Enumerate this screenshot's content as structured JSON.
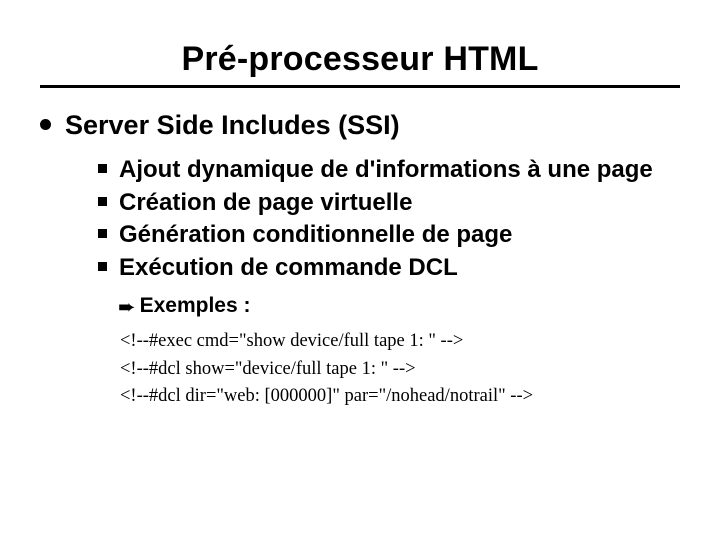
{
  "title": "Pré-processeur HTML",
  "lvl1": {
    "text": "Server Side Includes (SSI)"
  },
  "lvl2": [
    {
      "text": "Ajout dynamique de d'informations à une page"
    },
    {
      "text": "Création de page virtuelle"
    },
    {
      "text": "Génération conditionnelle de page"
    },
    {
      "text": "Exécution de commande DCL"
    }
  ],
  "lvl3": {
    "text": "Exemples :"
  },
  "code": [
    "<!--#exec cmd=\"show device/full tape 1: \" -->",
    "<!--#dcl show=\"device/full tape 1: \" -->",
    "<!--#dcl dir=\"web: [000000]\" par=\"/nohead/notrail\" -->"
  ]
}
